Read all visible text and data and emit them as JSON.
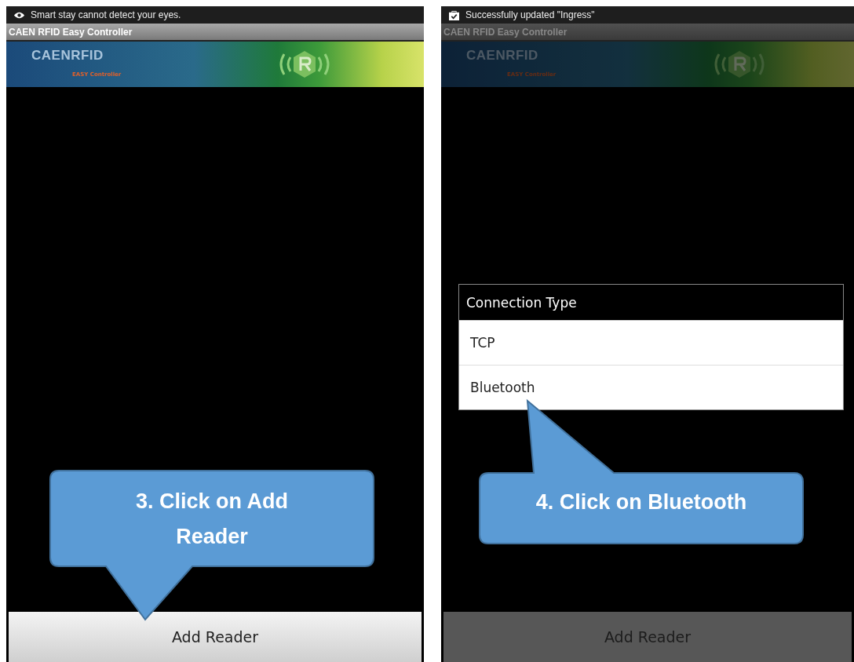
{
  "screens": [
    {
      "status_bar": {
        "kind": "eye",
        "text": "Smart stay cannot detect your eyes."
      },
      "title": "CAEN RFID Easy Controller",
      "banner": {
        "logo": "CAENRFID",
        "subtitle": "EASY Controller"
      },
      "dimmed": false,
      "button": "Add Reader",
      "callout": {
        "kind": "below",
        "text": "3. Click on Add Reader"
      }
    },
    {
      "status_bar": {
        "kind": "check",
        "text": "Successfully updated \"Ingress\""
      },
      "title": "CAEN RFID Easy Controller",
      "banner": {
        "logo": "CAENRFID",
        "subtitle": "EASY Controller"
      },
      "dimmed": true,
      "dialog": {
        "title": "Connection Type",
        "options": [
          "TCP",
          "Bluetooth"
        ]
      },
      "button": "Add Reader",
      "callout": {
        "kind": "above",
        "text": "4. Click on Bluetooth"
      }
    }
  ]
}
